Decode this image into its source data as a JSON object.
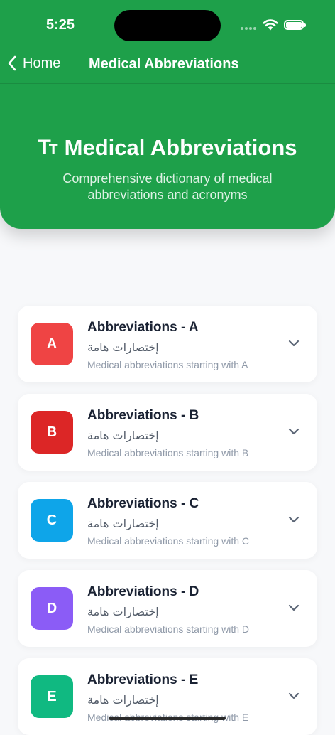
{
  "status_bar": {
    "time": "5:25"
  },
  "nav": {
    "back_label": "Home",
    "title": "Medical Abbreviations"
  },
  "hero": {
    "icon": "text-size-icon",
    "title": "Medical Abbreviations",
    "subtitle": "Comprehensive dictionary of medical abbreviations and acronyms"
  },
  "colors": {
    "header_green": "#1ea04a",
    "badge_a": "#ef4444",
    "badge_b": "#dc2626",
    "badge_c": "#0ea5e9",
    "badge_d": "#8b5cf6",
    "badge_e": "#10b981"
  },
  "cards": [
    {
      "letter": "A",
      "title": "Abbreviations - A",
      "arabic": "إختصارات هامة",
      "description": "Medical abbreviations starting with A"
    },
    {
      "letter": "B",
      "title": "Abbreviations - B",
      "arabic": "إختصارات هامة",
      "description": "Medical abbreviations starting with B"
    },
    {
      "letter": "C",
      "title": "Abbreviations - C",
      "arabic": "إختصارات هامة",
      "description": "Medical abbreviations starting with C"
    },
    {
      "letter": "D",
      "title": "Abbreviations - D",
      "arabic": "إختصارات هامة",
      "description": "Medical abbreviations starting with D"
    },
    {
      "letter": "E",
      "title": "Abbreviations - E",
      "arabic": "إختصارات هامة",
      "description": "Medical abbreviations starting with E"
    }
  ]
}
